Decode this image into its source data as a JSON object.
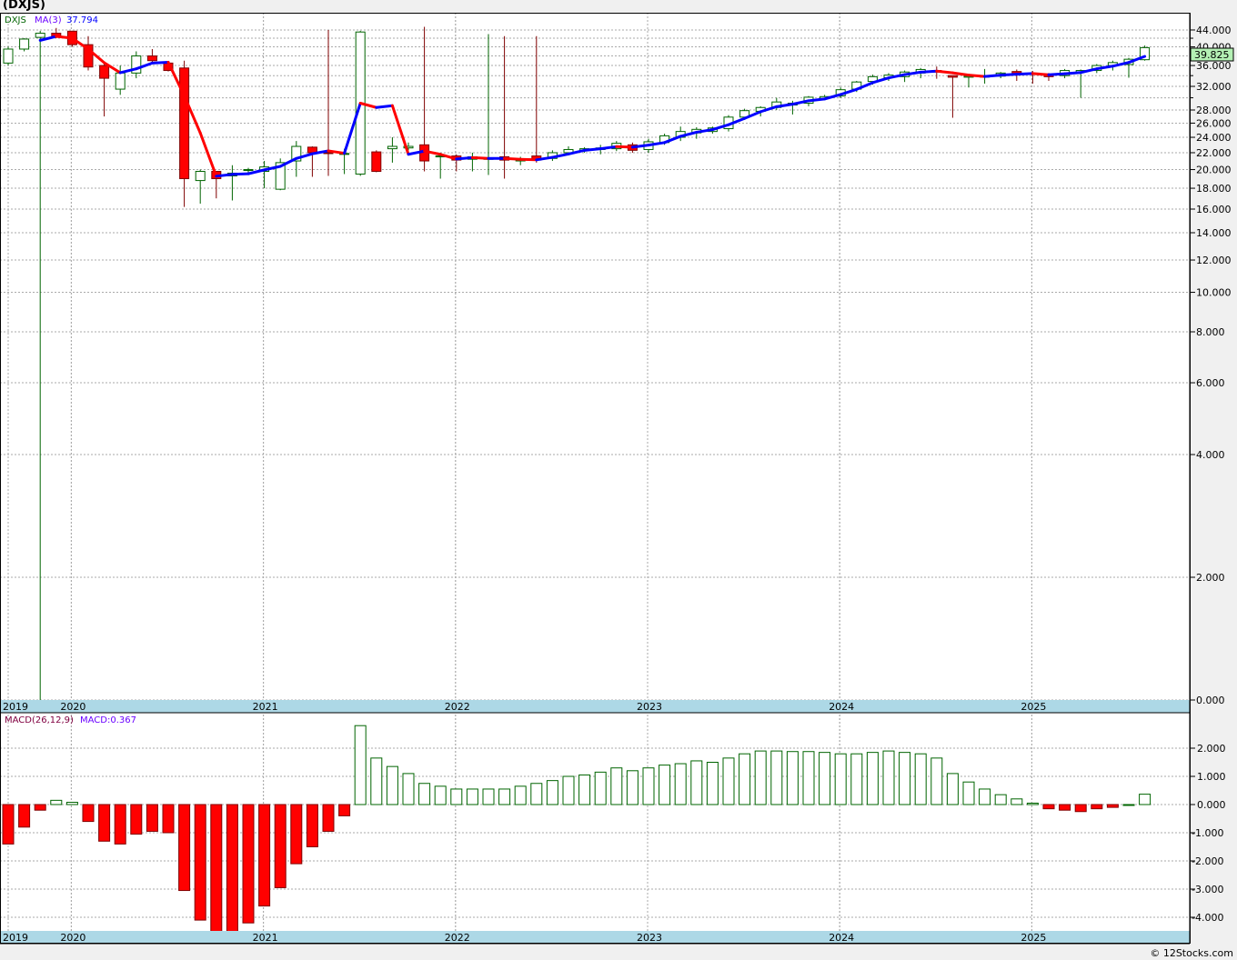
{
  "title": "(DXJS)",
  "footer": "© 12Stocks.com",
  "legend": {
    "symbol": "DXJS",
    "ma_label": "MA(3)",
    "ma_value": "37.794",
    "macd_label": "MACD(26,12,9)",
    "macd_value": "MACD:0.367"
  },
  "last_price": "39.825",
  "colors": {
    "up": "#006400",
    "down": "#ff0000",
    "ma_up": "#0000ff",
    "ma_down": "#ff0000",
    "axis_strip": "#add8e6",
    "price_badge": "#b4f0b4"
  },
  "chart_data": [
    {
      "type": "candlestick",
      "scale": "log",
      "period": "monthly",
      "start": "2019-09",
      "end": "2025-08",
      "grid": true,
      "year_labels": [
        "2019",
        "2020",
        "2021",
        "2022",
        "2023",
        "2024",
        "2025"
      ],
      "year_months": [
        -99,
        4,
        16,
        28,
        40,
        52,
        64
      ],
      "ticks": [
        {
          "v": 44,
          "label": "44.000"
        },
        {
          "v": 40,
          "label": "40.000"
        },
        {
          "v": 36,
          "label": "36.000"
        },
        {
          "v": 32,
          "label": "32.000"
        },
        {
          "v": 28,
          "label": "28.000"
        },
        {
          "v": 26,
          "label": "26.000"
        },
        {
          "v": 24,
          "label": "24.000"
        },
        {
          "v": 22,
          "label": "22.000"
        },
        {
          "v": 20,
          "label": "20.000"
        },
        {
          "v": 18,
          "label": "18.000"
        },
        {
          "v": 16,
          "label": "16.000"
        },
        {
          "v": 14,
          "label": "14.000"
        },
        {
          "v": 12,
          "label": "12.000"
        },
        {
          "v": 10,
          "label": "10.000"
        },
        {
          "v": 8,
          "label": "8.000"
        },
        {
          "v": 6,
          "label": "6.000"
        },
        {
          "v": 4,
          "label": "4.000"
        },
        {
          "v": 2,
          "label": "2.000"
        },
        {
          "v": 1,
          "label": "0.000"
        }
      ],
      "minor_ticks": [
        42,
        38,
        34,
        30
      ],
      "ohlc": [
        [
          36.5,
          40,
          36,
          39.5
        ],
        [
          39.5,
          42,
          39,
          41.8
        ],
        [
          42.2,
          43.8,
          1.0,
          43.2
        ],
        [
          43.2,
          44.5,
          42,
          42.3
        ],
        [
          43.7,
          43.8,
          40,
          40.5
        ],
        [
          40.5,
          42.5,
          35,
          35.7
        ],
        [
          36,
          36.5,
          27,
          33.5
        ],
        [
          31.5,
          36,
          30.5,
          34.5
        ],
        [
          34.5,
          39,
          33.5,
          38
        ],
        [
          38,
          39.5,
          36.5,
          37
        ],
        [
          36.5,
          36.5,
          34.8,
          35
        ],
        [
          35.5,
          37,
          16.2,
          19
        ],
        [
          18.8,
          20,
          16.5,
          19.8
        ],
        [
          19.8,
          19.8,
          17,
          19
        ],
        [
          19.3,
          20.5,
          16.8,
          19.6
        ],
        [
          19.9,
          20.2,
          19.5,
          20
        ],
        [
          19.8,
          21,
          18,
          20.3
        ],
        [
          17.9,
          21.3,
          17.8,
          20.8
        ],
        [
          21,
          23.5,
          19.2,
          22.8
        ],
        [
          22.7,
          22.8,
          19.2,
          22
        ],
        [
          22,
          44,
          19.3,
          21.9
        ],
        [
          21.8,
          22.5,
          19.5,
          21.9
        ],
        [
          19.5,
          43.8,
          19.3,
          43.5
        ],
        [
          22.1,
          22.3,
          19.7,
          19.8
        ],
        [
          22.5,
          24,
          20.8,
          22.8
        ],
        [
          22.6,
          23.3,
          22.3,
          22.8
        ],
        [
          23,
          44.8,
          19.8,
          21
        ],
        [
          21.5,
          22,
          19,
          21.6
        ],
        [
          21.6,
          21.8,
          19.8,
          21.1
        ],
        [
          21.2,
          22,
          19.8,
          21.5
        ],
        [
          21.2,
          43,
          19.4,
          21.3
        ],
        [
          21.5,
          42.5,
          19,
          21.1
        ],
        [
          21,
          21.5,
          20.5,
          21.2
        ],
        [
          21.6,
          42.5,
          20.8,
          21.1
        ],
        [
          21.3,
          22.3,
          21,
          22
        ],
        [
          22,
          22.8,
          21.8,
          22.4
        ],
        [
          22.3,
          22.7,
          22,
          22.5
        ],
        [
          22.4,
          23,
          21.8,
          22.6
        ],
        [
          22.5,
          23.5,
          22.2,
          23.2
        ],
        [
          23,
          23.3,
          22,
          22.3
        ],
        [
          22.4,
          23.8,
          22,
          23.4
        ],
        [
          23.3,
          24.5,
          23,
          24.2
        ],
        [
          24,
          25.5,
          23.5,
          24.8
        ],
        [
          24.6,
          25.4,
          23.8,
          25.1
        ],
        [
          24.8,
          25.5,
          24.5,
          25.3
        ],
        [
          25.2,
          27.2,
          24.8,
          26.9
        ],
        [
          26.9,
          28.2,
          26.5,
          27.9
        ],
        [
          27.8,
          28.6,
          27,
          28.4
        ],
        [
          28.4,
          30,
          28,
          29.3
        ],
        [
          28.8,
          29.5,
          27.3,
          29.1
        ],
        [
          29.1,
          30.3,
          28.6,
          30.1
        ],
        [
          29.9,
          30.5,
          29.7,
          30.2
        ],
        [
          30.3,
          31.8,
          30,
          31.4
        ],
        [
          31.5,
          33,
          31,
          32.8
        ],
        [
          32.9,
          34.2,
          32.3,
          33.8
        ],
        [
          33.6,
          34.5,
          33,
          34.1
        ],
        [
          33.8,
          35,
          32.8,
          34.7
        ],
        [
          34.5,
          35.5,
          33.5,
          35.2
        ],
        [
          35,
          35.8,
          33.4,
          34.7
        ],
        [
          34,
          34,
          26.8,
          33.7
        ],
        [
          33.7,
          34.2,
          31.8,
          33.9
        ],
        [
          33.8,
          35.3,
          32.5,
          33.9
        ],
        [
          33.9,
          34.7,
          33.5,
          34.5
        ],
        [
          34.8,
          35.2,
          33,
          34.4
        ],
        [
          34.4,
          34.9,
          32.5,
          34.3
        ],
        [
          34.3,
          34.5,
          33,
          33.8
        ],
        [
          34,
          35.3,
          33.5,
          35
        ],
        [
          34.7,
          35.2,
          30,
          35
        ],
        [
          35,
          36.3,
          34.5,
          36
        ],
        [
          36,
          37,
          35,
          36.6
        ],
        [
          36.2,
          37.6,
          33.6,
          37.3
        ],
        [
          37.2,
          40.3,
          37,
          39.825
        ]
      ],
      "ma_period": 3
    },
    {
      "type": "bar",
      "name": "MACD(26,12,9)",
      "ylim": [
        -4.5,
        2.9
      ],
      "ticks": [
        {
          "v": 2,
          "label": "2.000"
        },
        {
          "v": 1,
          "label": "1.000"
        },
        {
          "v": 0,
          "label": "0.000"
        },
        {
          "v": -1,
          "label": "-1.000"
        },
        {
          "v": -2,
          "label": "-2.000"
        },
        {
          "v": -3,
          "label": "-3.000"
        },
        {
          "v": -4,
          "label": "-4.000"
        }
      ],
      "values": [
        -1.4,
        -0.8,
        -0.2,
        0.15,
        0.08,
        -0.6,
        -1.3,
        -1.4,
        -1.05,
        -0.95,
        -1.0,
        -3.05,
        -4.1,
        -4.5,
        -4.5,
        -4.2,
        -3.6,
        -2.95,
        -2.1,
        -1.5,
        -0.95,
        -0.4,
        2.8,
        1.65,
        1.35,
        1.1,
        0.75,
        0.65,
        0.55,
        0.55,
        0.55,
        0.55,
        0.65,
        0.75,
        0.85,
        1.0,
        1.05,
        1.15,
        1.3,
        1.2,
        1.3,
        1.4,
        1.45,
        1.55,
        1.5,
        1.65,
        1.8,
        1.9,
        1.9,
        1.88,
        1.88,
        1.85,
        1.8,
        1.8,
        1.85,
        1.9,
        1.85,
        1.8,
        1.65,
        1.1,
        0.8,
        0.55,
        0.35,
        0.2,
        0.05,
        -0.15,
        -0.2,
        -0.25,
        -0.15,
        -0.1,
        0.0,
        0.367
      ]
    }
  ]
}
